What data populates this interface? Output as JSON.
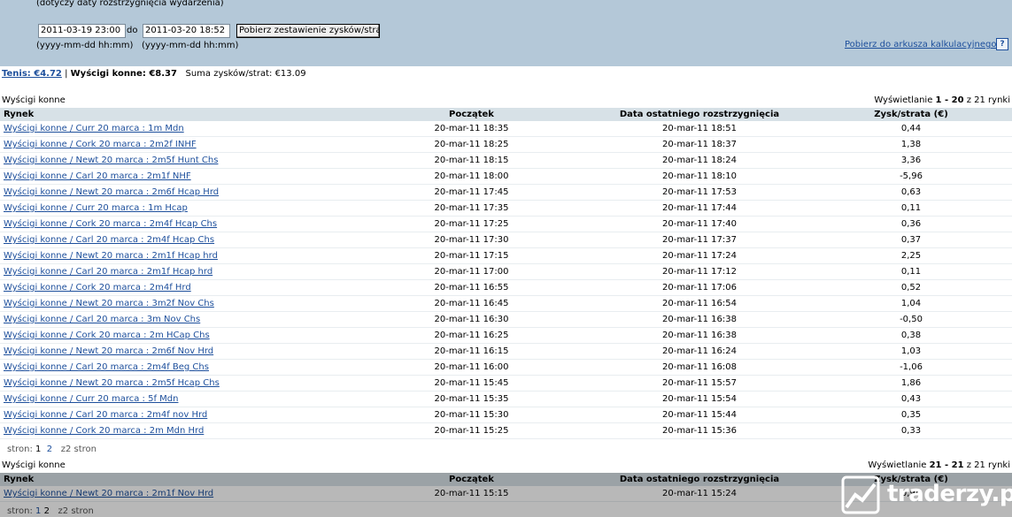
{
  "filter": {
    "note": "(dotyczy daty rozstrzygnięcia wydarzenia)",
    "date_from": "2011-03-19 23:00",
    "to_label": "do",
    "date_to": "2011-03-20 18:52",
    "fetch_button": "Pobierz zestawienie zysków/strat",
    "format_hint_from": "(yyyy-mm-dd hh:mm)",
    "format_hint_to": "(yyyy-mm-dd hh:mm)",
    "spreadsheet_link": "Pobierz do arkusza kalkulacyjnego",
    "help_icon": "?"
  },
  "summary": {
    "tennis_link": "Tenis: €4.72",
    "separator": "|",
    "horse_label": "Wyścigi konne: €8.37",
    "total_label": "Suma zysków/strat:",
    "total_value": "€13.09"
  },
  "columns": {
    "market": "Rynek",
    "start": "Początek",
    "settled": "Data ostatniego rozstrzygnięcia",
    "pnl": "Zysk/strata (€)"
  },
  "section1": {
    "title": "Wyścigi konne",
    "paging_prefix": "Wyświetlanie ",
    "paging_range": "1 - 20",
    "paging_suffix": " z 21 rynki",
    "rows": [
      {
        "market": "Wyścigi konne / Curr 20 marca : 1m Mdn",
        "start": "20-mar-11 18:35",
        "settled": "20-mar-11 18:51",
        "pnl": "0,44"
      },
      {
        "market": "Wyścigi konne / Cork 20 marca : 2m2f INHF",
        "start": "20-mar-11 18:25",
        "settled": "20-mar-11 18:37",
        "pnl": "1,38"
      },
      {
        "market": "Wyścigi konne / Newt 20 marca : 2m5f Hunt Chs",
        "start": "20-mar-11 18:15",
        "settled": "20-mar-11 18:24",
        "pnl": "3,36"
      },
      {
        "market": "Wyścigi konne / Carl 20 marca : 2m1f NHF",
        "start": "20-mar-11 18:00",
        "settled": "20-mar-11 18:10",
        "pnl": "-5,96"
      },
      {
        "market": "Wyścigi konne / Newt 20 marca : 2m6f Hcap Hrd",
        "start": "20-mar-11 17:45",
        "settled": "20-mar-11 17:53",
        "pnl": "0,63"
      },
      {
        "market": "Wyścigi konne / Curr 20 marca : 1m Hcap",
        "start": "20-mar-11 17:35",
        "settled": "20-mar-11 17:44",
        "pnl": "0,11"
      },
      {
        "market": "Wyścigi konne / Cork 20 marca : 2m4f Hcap Chs",
        "start": "20-mar-11 17:25",
        "settled": "20-mar-11 17:40",
        "pnl": "0,36"
      },
      {
        "market": "Wyścigi konne / Carl 20 marca : 2m4f Hcap Chs",
        "start": "20-mar-11 17:30",
        "settled": "20-mar-11 17:37",
        "pnl": "0,37"
      },
      {
        "market": "Wyścigi konne / Newt 20 marca : 2m1f Hcap hrd",
        "start": "20-mar-11 17:15",
        "settled": "20-mar-11 17:24",
        "pnl": "2,25"
      },
      {
        "market": "Wyścigi konne / Carl 20 marca : 2m1f Hcap hrd",
        "start": "20-mar-11 17:00",
        "settled": "20-mar-11 17:12",
        "pnl": "0,11"
      },
      {
        "market": "Wyścigi konne / Cork 20 marca : 2m4f Hrd",
        "start": "20-mar-11 16:55",
        "settled": "20-mar-11 17:06",
        "pnl": "0,52"
      },
      {
        "market": "Wyścigi konne / Newt 20 marca : 3m2f Nov Chs",
        "start": "20-mar-11 16:45",
        "settled": "20-mar-11 16:54",
        "pnl": "1,04"
      },
      {
        "market": "Wyścigi konne / Carl 20 marca : 3m Nov Chs",
        "start": "20-mar-11 16:30",
        "settled": "20-mar-11 16:38",
        "pnl": "-0,50"
      },
      {
        "market": "Wyścigi konne / Cork 20 marca : 2m HCap Chs",
        "start": "20-mar-11 16:25",
        "settled": "20-mar-11 16:38",
        "pnl": "0,38"
      },
      {
        "market": "Wyścigi konne / Newt 20 marca : 2m6f Nov Hrd",
        "start": "20-mar-11 16:15",
        "settled": "20-mar-11 16:24",
        "pnl": "1,03"
      },
      {
        "market": "Wyścigi konne / Carl 20 marca : 2m4f Beg Chs",
        "start": "20-mar-11 16:00",
        "settled": "20-mar-11 16:08",
        "pnl": "-1,06"
      },
      {
        "market": "Wyścigi konne / Newt 20 marca : 2m5f Hcap Chs",
        "start": "20-mar-11 15:45",
        "settled": "20-mar-11 15:57",
        "pnl": "1,86"
      },
      {
        "market": "Wyścigi konne / Curr 20 marca : 5f Mdn",
        "start": "20-mar-11 15:35",
        "settled": "20-mar-11 15:54",
        "pnl": "0,43"
      },
      {
        "market": "Wyścigi konne / Carl 20 marca : 2m4f nov Hrd",
        "start": "20-mar-11 15:30",
        "settled": "20-mar-11 15:44",
        "pnl": "0,35"
      },
      {
        "market": "Wyścigi konne / Cork 20 marca : 2m Mdn Hrd",
        "start": "20-mar-11 15:25",
        "settled": "20-mar-11 15:36",
        "pnl": "0,33"
      }
    ],
    "pager_label": "stron:",
    "pager_current": "1",
    "pager_next": "2",
    "pager_total": "z2 stron"
  },
  "section2": {
    "title": "Wyścigi konne",
    "paging_prefix": "Wyświetlanie ",
    "paging_range": "21 - 21",
    "paging_suffix": " z 21 rynki",
    "rows": [
      {
        "market": "Wyścigi konne / Newt 20 marca : 2m1f Nov Hrd",
        "start": "20-mar-11 15:15",
        "settled": "20-mar-11 15:24",
        "pnl": "0,94"
      }
    ],
    "pager_label": "stron:",
    "pager_first": "1",
    "pager_current": "2",
    "pager_total": "z2 stron"
  },
  "watermark": {
    "text": "traderzy.pl",
    "icon": "chart-logo-icon"
  }
}
